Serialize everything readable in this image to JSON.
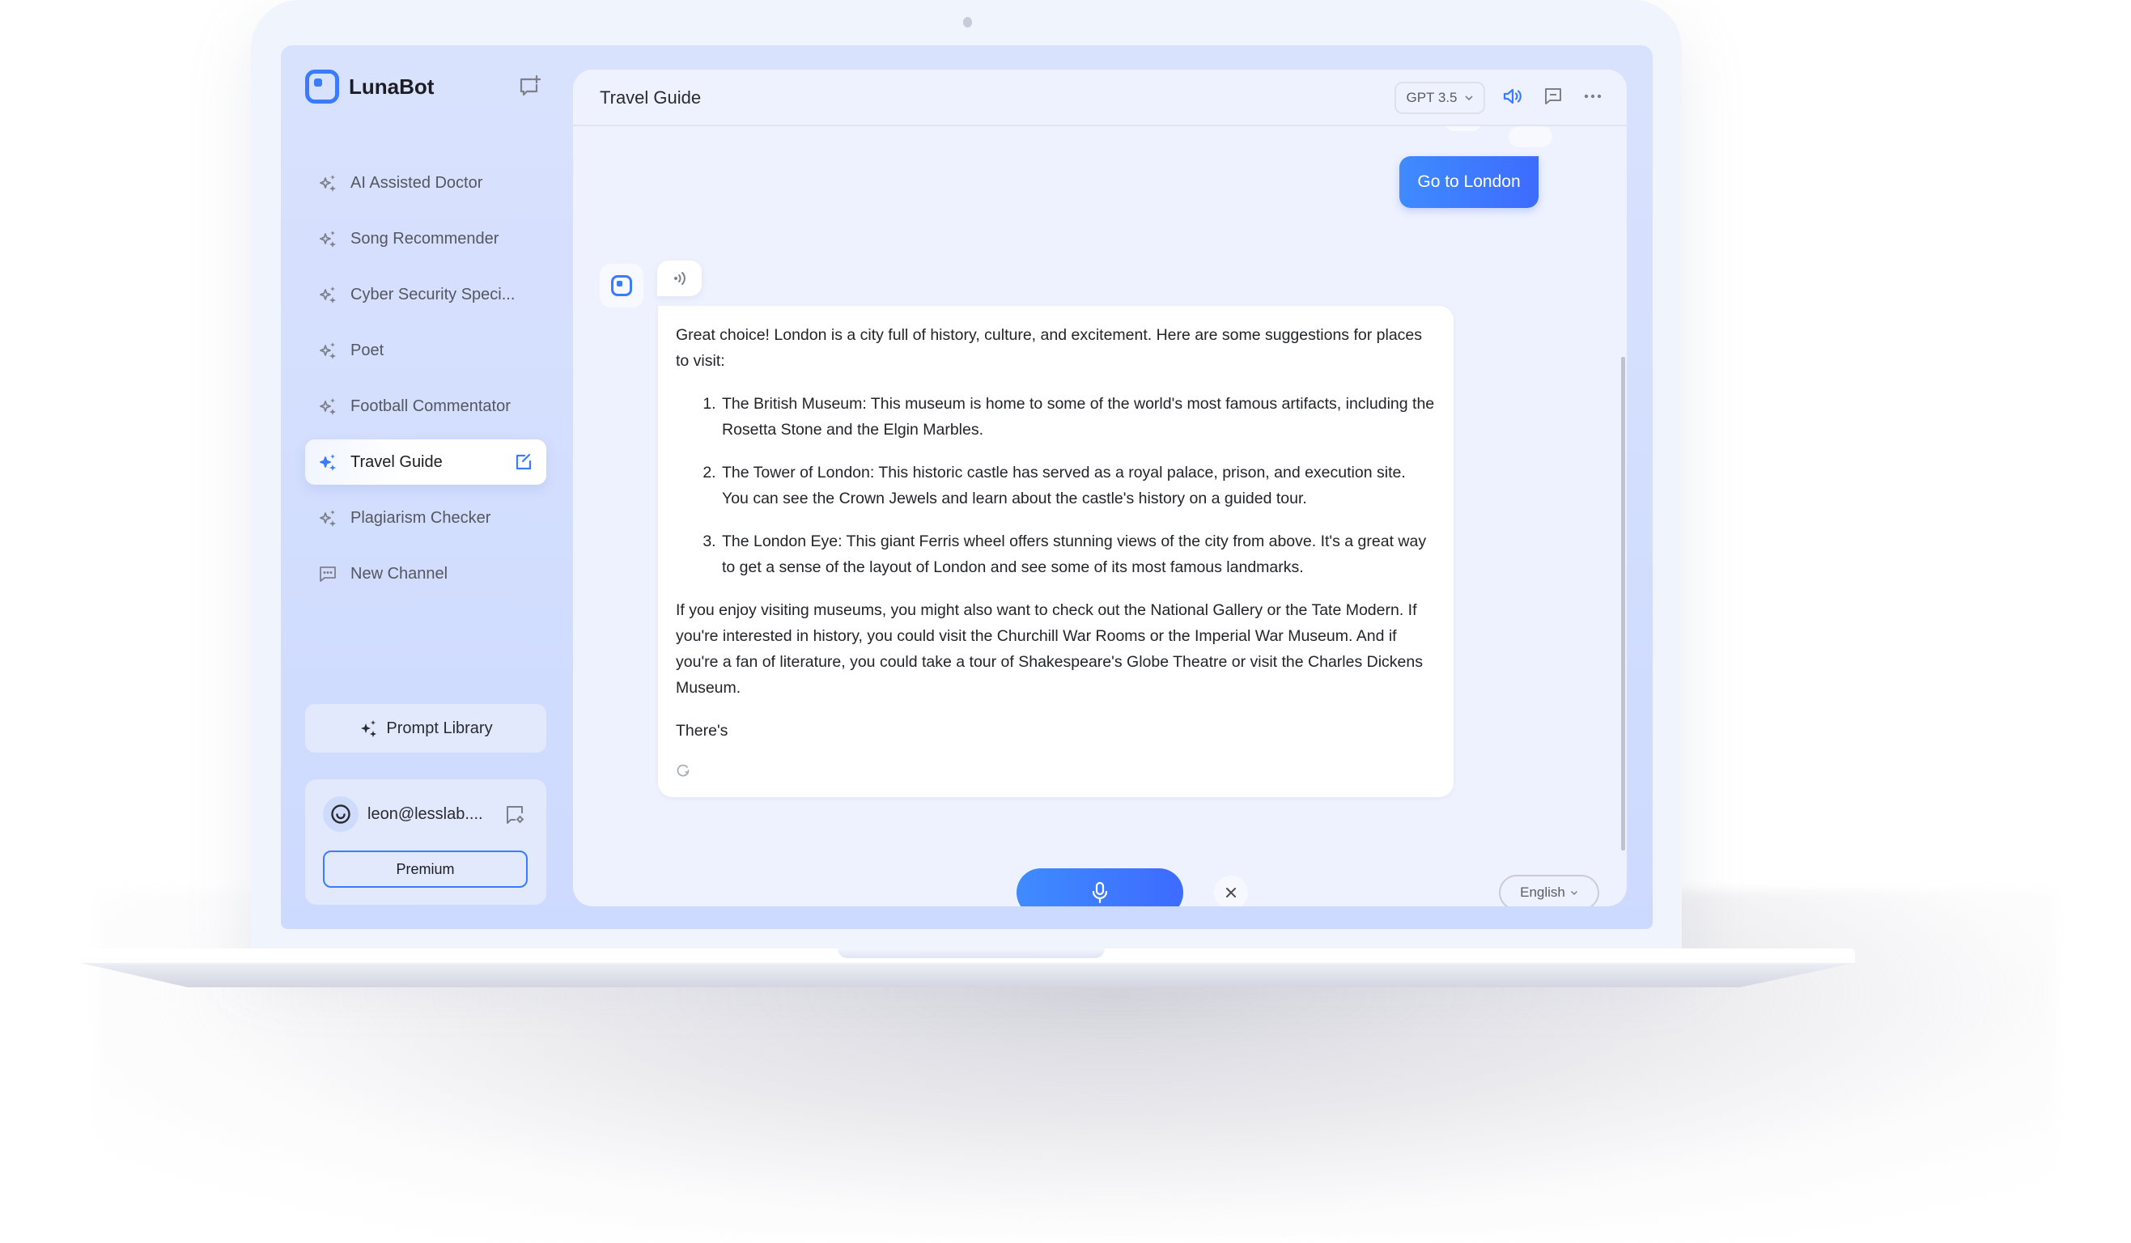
{
  "app": {
    "name": "LunaBot",
    "accent_color": "#3a7bff"
  },
  "sidebar": {
    "new_chat_icon": "chat-plus-icon",
    "items": [
      {
        "label": "AI Assisted Doctor",
        "icon": "sparkles-icon",
        "active": false
      },
      {
        "label": "Song Recommender",
        "icon": "sparkles-icon",
        "active": false
      },
      {
        "label": "Cyber Security Speci...",
        "icon": "sparkles-icon",
        "active": false
      },
      {
        "label": "Poet",
        "icon": "sparkles-icon",
        "active": false
      },
      {
        "label": "Football Commentator",
        "icon": "sparkles-icon",
        "active": false
      },
      {
        "label": "Travel Guide",
        "icon": "sparkles-icon",
        "active": true
      },
      {
        "label": "Plagiarism Checker",
        "icon": "sparkles-icon",
        "active": false
      },
      {
        "label": "New Channel",
        "icon": "chat-bubble-icon",
        "active": false
      }
    ],
    "prompt_library_label": "Prompt Library",
    "user": {
      "email": "leon@lesslab....",
      "premium_label": "Premium"
    }
  },
  "chat": {
    "title": "Travel Guide",
    "model": "GPT 3.5",
    "user_message": "Go to London",
    "bot_message": {
      "intro": "Great choice! London is a city full of history, culture, and excitement. Here are some suggestions for places to visit:",
      "list": [
        "The British Museum: This museum is home to some of the world's most famous artifacts, including the Rosetta Stone and the Elgin Marbles.",
        "The Tower of London: This historic castle has served as a royal palace, prison, and execution site. You can see the Crown Jewels and learn about the castle's history on a guided tour.",
        "The London Eye: This giant Ferris wheel offers stunning views of the city from above. It's a great way to get a sense of the layout of London and see some of its most famous landmarks."
      ],
      "paragraph": "If you enjoy visiting museums, you might also want to check out the National Gallery or the Tate Modern. If you're interested in history, you could visit the Churchill War Rooms or the Imperial War Museum. And if you're a fan of literature, you could take a tour of Shakespeare's Globe Theatre or visit the Charles Dickens Museum.",
      "streaming_text": "There's",
      "status": "generating"
    },
    "language": "English"
  }
}
